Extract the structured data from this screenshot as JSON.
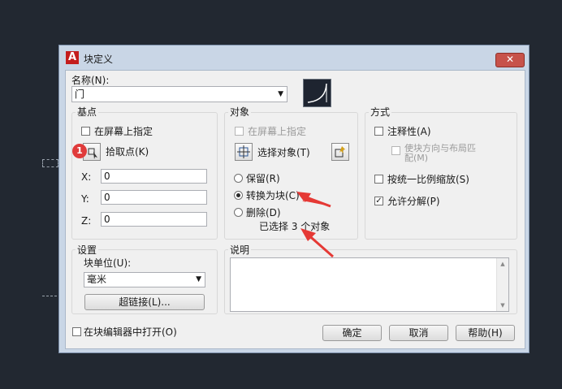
{
  "dialog": {
    "title": "块定义",
    "app_icon_glyph": "A",
    "close_glyph": "✕"
  },
  "name": {
    "label": "名称(N):",
    "value": "门"
  },
  "base_point": {
    "group_label": "基点",
    "specify_on_screen": "在屏幕上指定",
    "pick_point": "拾取点(K)",
    "x_label": "X:",
    "y_label": "Y:",
    "z_label": "Z:",
    "x": "0",
    "y": "0",
    "z": "0"
  },
  "objects": {
    "group_label": "对象",
    "specify_on_screen": "在屏幕上指定",
    "select_objects": "选择对象(T)",
    "retain": "保留(R)",
    "convert": "转换为块(C)",
    "delete": "删除(D)",
    "selected_count": "已选择 3 个对象"
  },
  "behavior": {
    "group_label": "方式",
    "annotative": "注释性(A)",
    "match_orientation": "使块方向与布局匹配(M)",
    "scale_uniformly": "按统一比例缩放(S)",
    "allow_exploding": "允许分解(P)"
  },
  "settings": {
    "group_label": "设置",
    "block_unit_label": "块单位(U):",
    "block_unit_value": "毫米",
    "hyperlink": "超链接(L)..."
  },
  "description": {
    "group_label": "说明",
    "value": ""
  },
  "footer": {
    "open_in_editor": "在块编辑器中打开(O)",
    "ok": "确定",
    "cancel": "取消",
    "help": "帮助(H)"
  },
  "annotation": {
    "step_badge": "1",
    "arrow_color": "#e53935"
  }
}
